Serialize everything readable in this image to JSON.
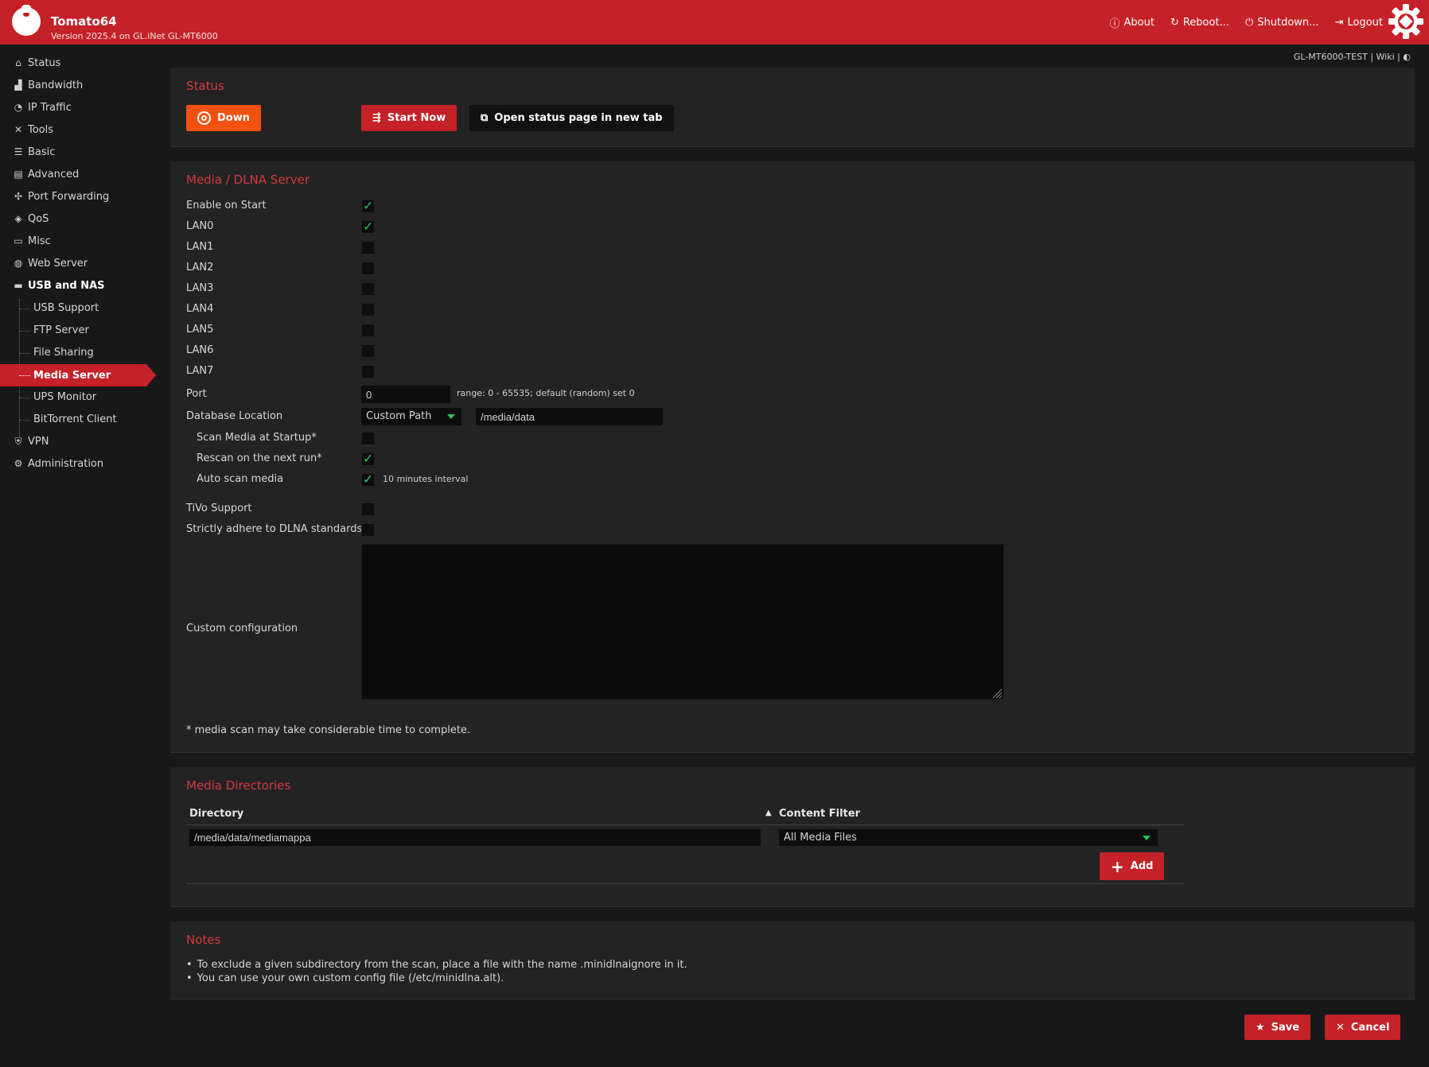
{
  "header": {
    "title": "Tomato64",
    "version": "Version 2025.4 on GL.iNet GL-MT6000",
    "nav": [
      {
        "label": "About",
        "icon": "info-icon"
      },
      {
        "label": "Reboot...",
        "icon": "reboot-icon"
      },
      {
        "label": "Shutdown...",
        "icon": "power-icon"
      },
      {
        "label": "Logout",
        "icon": "logout-icon"
      }
    ],
    "brand_color": "#c42128"
  },
  "top_strip": {
    "device": "GL-MT6000-TEST",
    "sep1": "|",
    "wiki": "Wiki",
    "sep2": "|",
    "theme": "◐"
  },
  "sidebar": {
    "items": [
      {
        "label": "Status",
        "icon": "home-icon"
      },
      {
        "label": "Bandwidth",
        "icon": "bar-chart-icon"
      },
      {
        "label": "IP Traffic",
        "icon": "pie-chart-icon"
      },
      {
        "label": "Tools",
        "icon": "tools-icon"
      },
      {
        "label": "Basic",
        "icon": "toggle-icon"
      },
      {
        "label": "Advanced",
        "icon": "router-icon"
      },
      {
        "label": "Port Forwarding",
        "icon": "network-icon"
      },
      {
        "label": "QoS",
        "icon": "tag-icon"
      },
      {
        "label": "Misc",
        "icon": "cast-icon"
      },
      {
        "label": "Web Server",
        "icon": "globe-icon"
      },
      {
        "label": "USB and NAS",
        "icon": "folder-icon"
      },
      {
        "label": "VPN",
        "icon": "shield-icon"
      },
      {
        "label": "Administration",
        "icon": "gear-icon"
      }
    ],
    "sub_items": [
      "USB Support",
      "FTP Server",
      "File Sharing",
      "Media Server",
      "UPS Monitor",
      "BitTorrent Client"
    ],
    "active": "Media Server"
  },
  "status": {
    "title": "Status",
    "state_label": "Down",
    "start_label": "Start Now",
    "open_label": "Open status page in new tab"
  },
  "media": {
    "title": "Media / DLNA Server",
    "enable_on_start": {
      "label": "Enable on Start",
      "checked": true
    },
    "lans": [
      {
        "label": "LAN0",
        "checked": true
      },
      {
        "label": "LAN1",
        "checked": false
      },
      {
        "label": "LAN2",
        "checked": false
      },
      {
        "label": "LAN3",
        "checked": false
      },
      {
        "label": "LAN4",
        "checked": false
      },
      {
        "label": "LAN5",
        "checked": false
      },
      {
        "label": "LAN6",
        "checked": false
      },
      {
        "label": "LAN7",
        "checked": false
      }
    ],
    "port": {
      "label": "Port",
      "value": "0",
      "hint": "range: 0 - 65535; default (random) set 0"
    },
    "db": {
      "label": "Database Location",
      "select": "Custom Path",
      "path": "/media/data"
    },
    "scan_startup": {
      "label": "Scan Media at Startup*",
      "checked": false
    },
    "rescan": {
      "label": "Rescan on the next run*",
      "checked": true
    },
    "auto_scan": {
      "label": "Auto scan media",
      "checked": true,
      "hint": "10 minutes interval"
    },
    "tivo": {
      "label": "TiVo Support",
      "checked": false
    },
    "strict": {
      "label": "Strictly adhere to DLNA standards",
      "checked": false
    },
    "custom": {
      "label": "Custom configuration",
      "value": ""
    },
    "footnote": "* media scan may take considerable time to complete."
  },
  "dirs": {
    "title": "Media Directories",
    "col_dir": "Directory",
    "col_filter": "Content Filter",
    "sort_icon": "▲",
    "dir_value": "/media/data/mediamappa",
    "filter_value": "All Media Files",
    "add_label": "Add"
  },
  "notes": {
    "title": "Notes",
    "items": [
      "To exclude a given subdirectory from the scan, place a file with the name .minidlnaignore in it.",
      "You can use your own custom config file (/etc/minidlna.alt)."
    ]
  },
  "footer": {
    "save_label": "Save",
    "cancel_label": "Cancel"
  },
  "colors": {
    "accent": "#c42128",
    "heading": "#d33a40",
    "down": "#f2510f",
    "check": "#27c55a"
  }
}
